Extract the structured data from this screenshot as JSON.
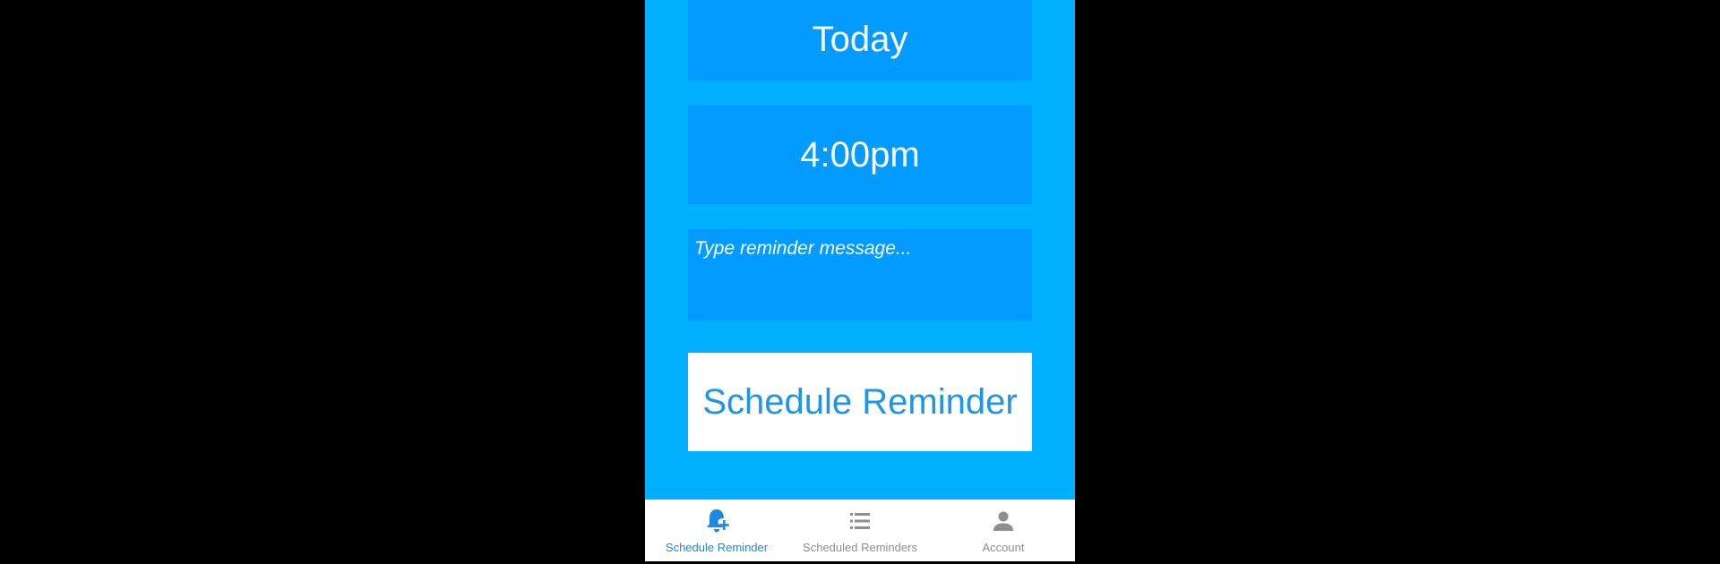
{
  "form": {
    "date_value": "Today",
    "time_value": "4:00pm",
    "message_placeholder": "Type reminder message...",
    "submit_label": "Schedule Reminder"
  },
  "nav": {
    "items": [
      {
        "label": "Schedule Reminder",
        "icon": "bell-plus-icon",
        "active": true
      },
      {
        "label": "Scheduled Reminders",
        "icon": "list-icon",
        "active": false
      },
      {
        "label": "Account",
        "icon": "person-icon",
        "active": false
      }
    ]
  },
  "colors": {
    "background": "#00B0FF",
    "field": "#039BFF",
    "button_text": "#1E96E8",
    "nav_active": "#1E88E5",
    "nav_inactive": "#8E8E8E"
  }
}
